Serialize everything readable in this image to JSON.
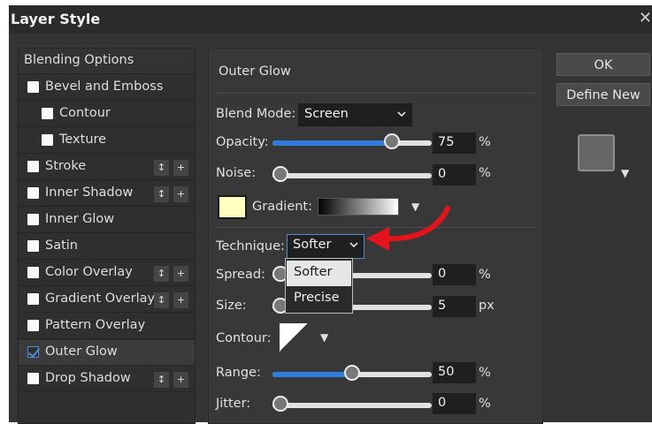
{
  "window": {
    "title": "Layer Style",
    "close_glyph": "✕"
  },
  "sidebar": {
    "header": "Blending Options",
    "items": [
      {
        "label": "Bevel and Emboss",
        "checked": false
      },
      {
        "label": "Contour",
        "checked": false
      },
      {
        "label": "Texture",
        "checked": false
      },
      {
        "label": "Stroke",
        "checked": false
      },
      {
        "label": "Inner Shadow",
        "checked": false
      },
      {
        "label": "Inner Glow",
        "checked": false
      },
      {
        "label": "Satin",
        "checked": false
      },
      {
        "label": "Color Overlay",
        "checked": false
      },
      {
        "label": "Gradient Overlay",
        "checked": false
      },
      {
        "label": "Pattern Overlay",
        "checked": false
      },
      {
        "label": "Outer Glow",
        "checked": true
      },
      {
        "label": "Drop Shadow",
        "checked": false
      }
    ],
    "updown_glyph": "↕",
    "plus_glyph": "+"
  },
  "panel": {
    "title": "Outer Glow",
    "blend_mode": {
      "label": "Blend Mode:",
      "value": "Screen"
    },
    "opacity": {
      "label": "Opacity:",
      "value": "75",
      "unit": "%",
      "level": 0.75
    },
    "noise": {
      "label": "Noise:",
      "value": "0",
      "unit": "%",
      "level": 0
    },
    "glow_color": "#ffffc0",
    "gradient_label": "Gradient:",
    "technique": {
      "label": "Technique:",
      "value": "Softer",
      "options": [
        "Softer",
        "Precise"
      ],
      "highlighted": "Softer"
    },
    "spread": {
      "label": "Spread:",
      "value": "0",
      "unit": "%"
    },
    "size": {
      "label": "Size:",
      "value": "5",
      "unit": "px"
    },
    "contour_label": "Contour:",
    "range": {
      "label": "Range:",
      "value": "50",
      "unit": "%",
      "level": 0.5
    },
    "jitter": {
      "label": "Jitter:",
      "value": "0",
      "unit": "%",
      "level": 0
    }
  },
  "buttons": {
    "ok": "OK",
    "define_new": "Define New"
  },
  "icons": {
    "chevron": "chevron-down-icon",
    "triangle": "▼",
    "arrow": "red-curved-arrow-annotation"
  },
  "colors": {
    "accent": "#2f7de1",
    "annotation": "#e3141b",
    "dialog_bg": "#343434"
  }
}
